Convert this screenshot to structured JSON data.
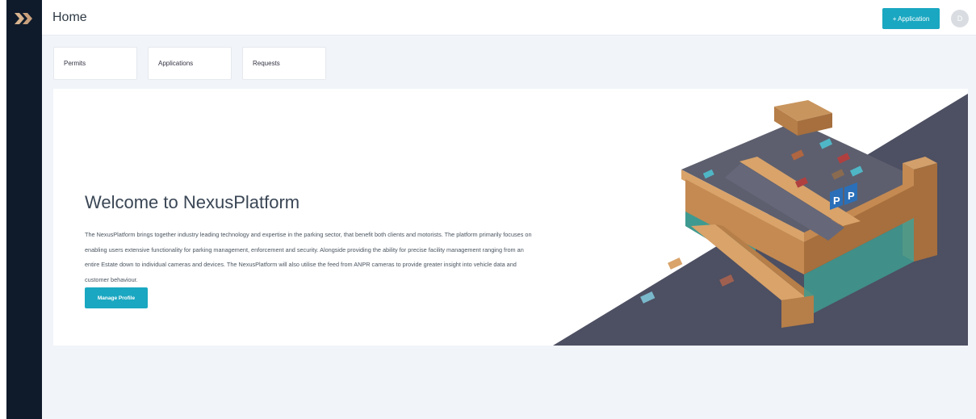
{
  "header": {
    "title": "Home",
    "add_application_label": "+ Application",
    "avatar_initial": "D"
  },
  "tabs": [
    {
      "label": "Permits"
    },
    {
      "label": "Applications"
    },
    {
      "label": "Requests"
    }
  ],
  "hero": {
    "title": "Welcome to NexusPlatform",
    "description": "The NexusPlatform brings together industry leading technology and expertise in the parking sector, that benefit both clients and motorists. The platform primarily focuses on enabling users extensive functionality for parking management, enforcement and security. Alongside providing the ability for precise facility management ranging from an entire Estate down to individual cameras and devices. The NexusPlatform will also utilise the feed from ANPR cameras to provide greater insight into vehicle data and customer behaviour.",
    "manage_profile_label": "Manage Profile",
    "parking_sign_letters": [
      "P",
      "P"
    ]
  },
  "colors": {
    "sidebar": "#0f1b2b",
    "accent": "#1aa7c1",
    "background": "#f1f4f9",
    "logo_primary": "#d9b48f",
    "road": "#4d4f62"
  },
  "icons": {
    "logo": "double-chevron-logo-icon",
    "parking_sign": "parking-sign-icon"
  }
}
